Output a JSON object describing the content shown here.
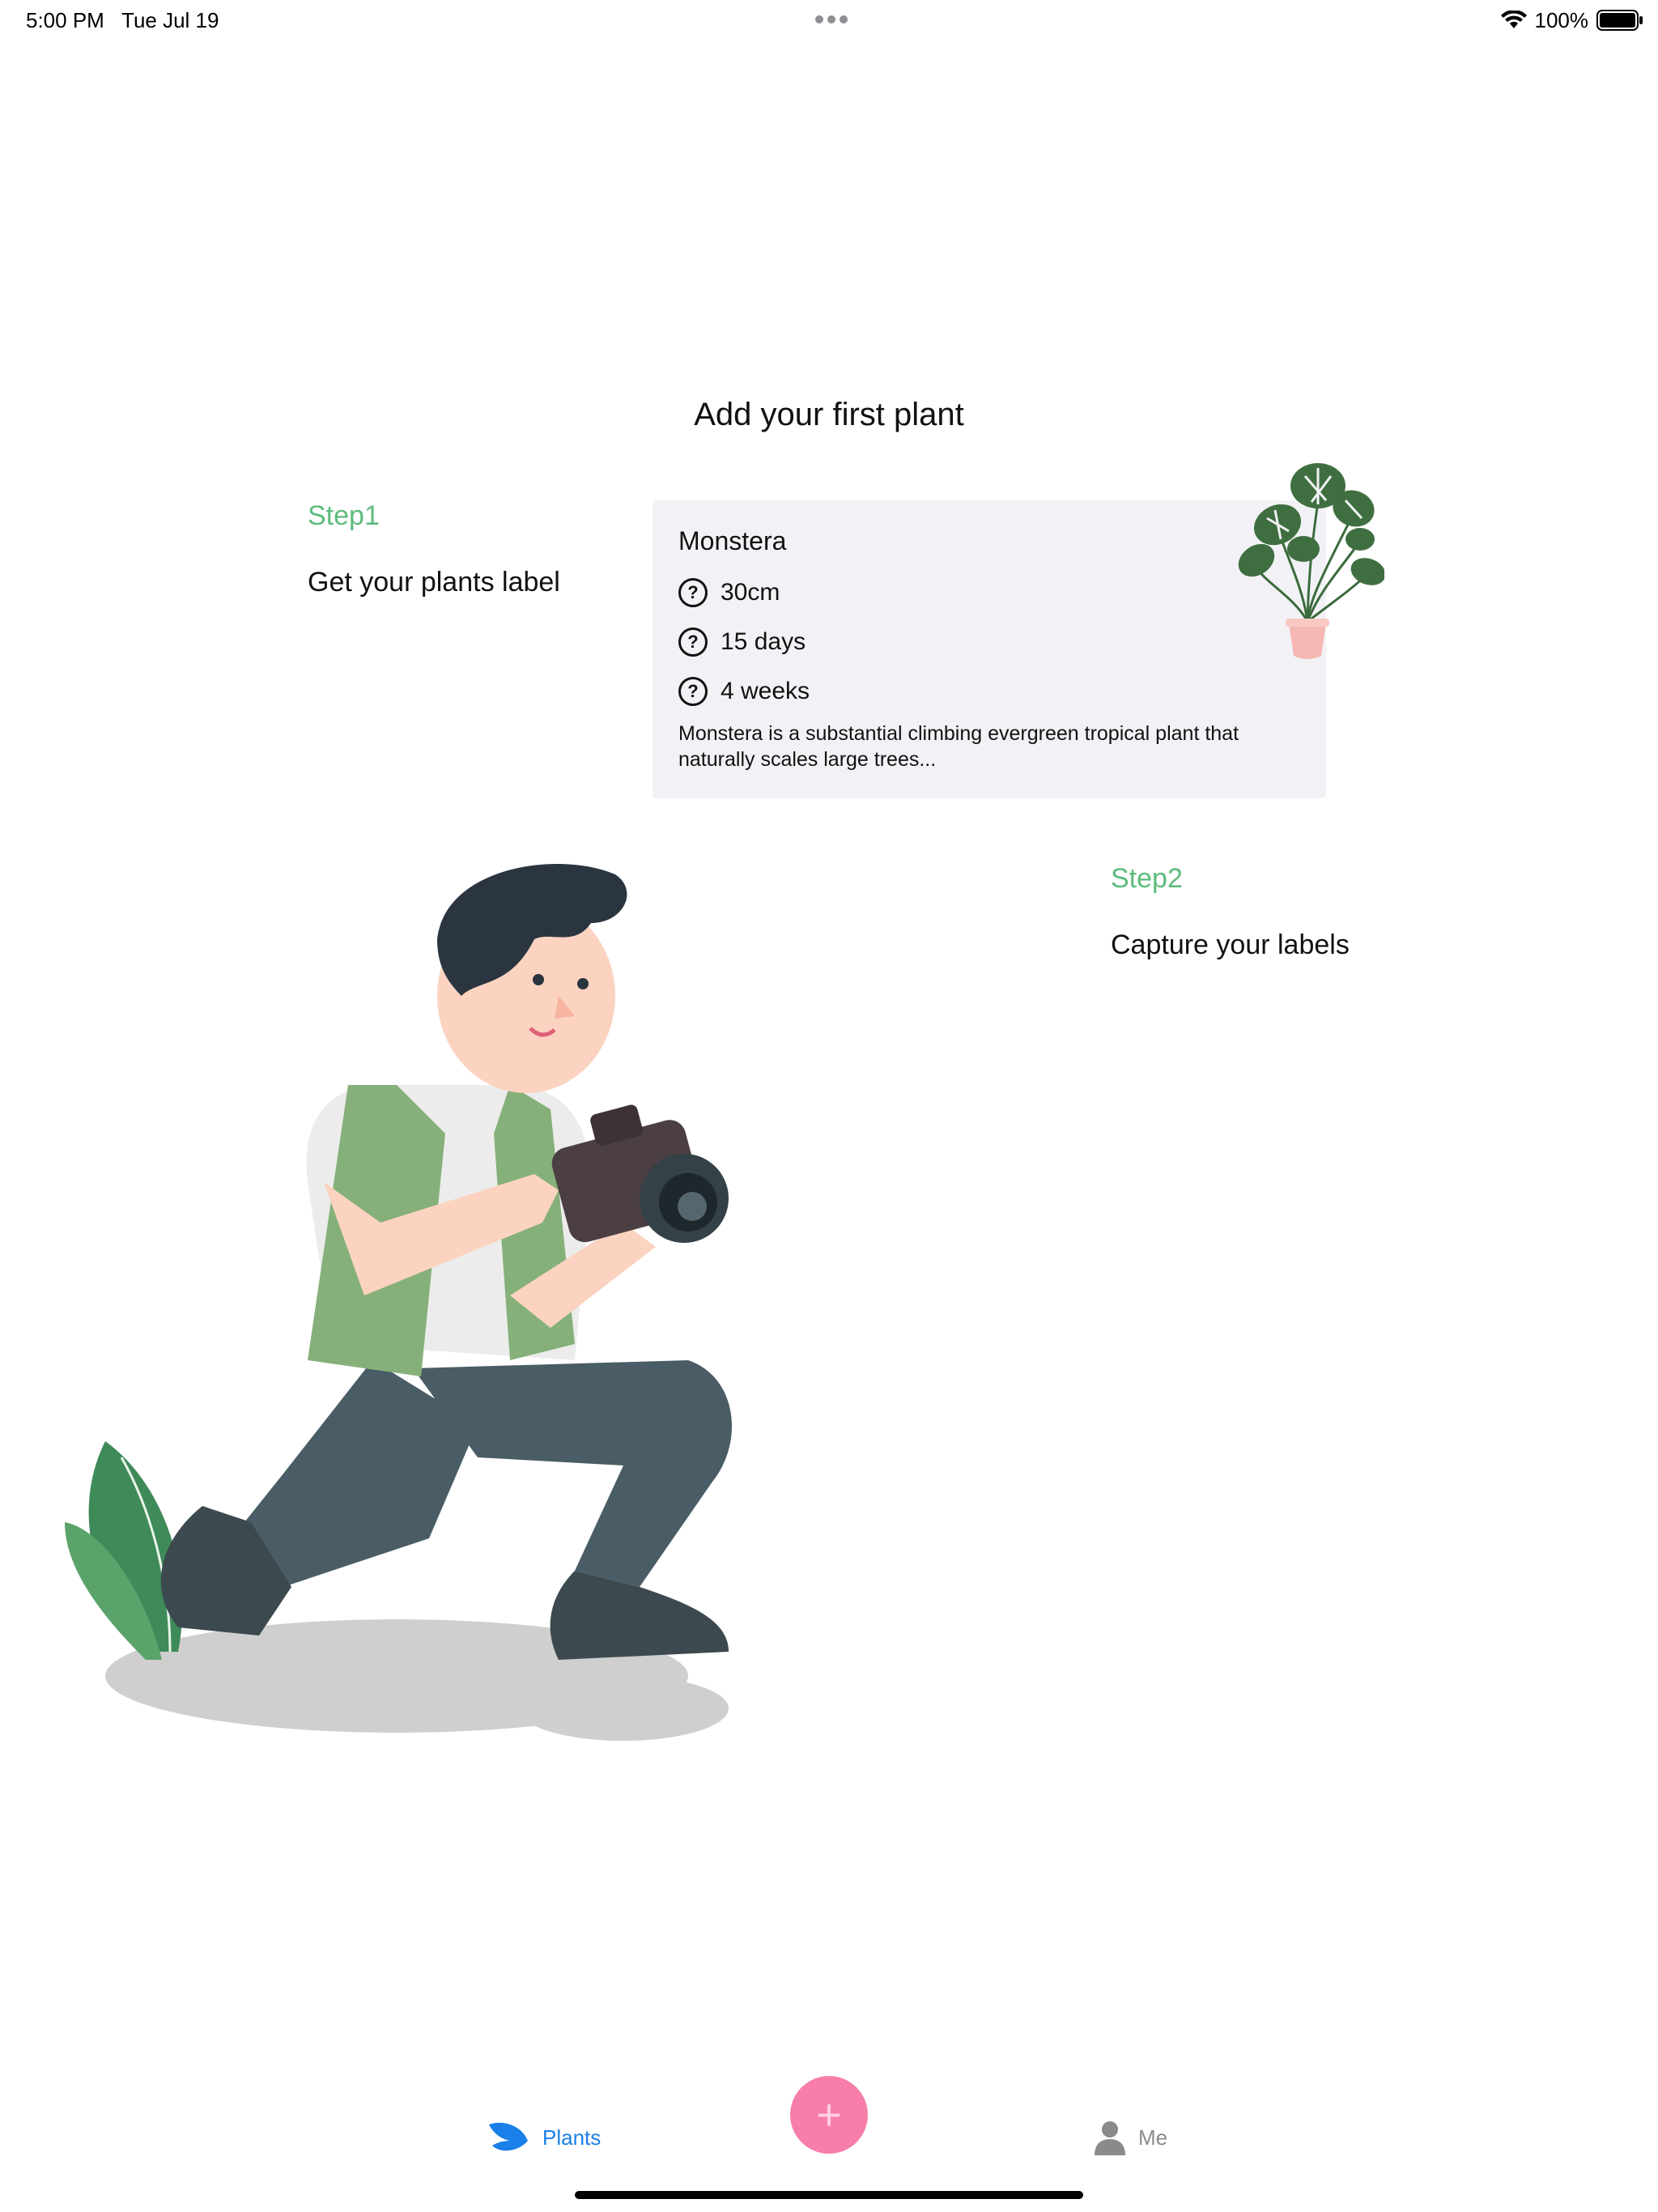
{
  "status_bar": {
    "time": "5:00 PM",
    "date": "Tue Jul 19",
    "battery": "100%"
  },
  "page": {
    "title": "Add your first plant"
  },
  "steps": [
    {
      "label": "Step1",
      "text": "Get your plants label"
    },
    {
      "label": "Step2",
      "text": "Capture your labels"
    }
  ],
  "plant_card": {
    "name": "Monstera",
    "rows": [
      {
        "icon": "question-circle-icon",
        "value": "30cm"
      },
      {
        "icon": "question-circle-icon",
        "value": "15 days"
      },
      {
        "icon": "question-circle-icon",
        "value": "4 weeks"
      }
    ],
    "description": "Monstera is a substantial climbing evergreen tropical plant that naturally scales large trees..."
  },
  "tab_bar": {
    "plants_label": "Plants",
    "me_label": "Me",
    "add_symbol": "+",
    "active_color": "#1a7fe8",
    "inactive_color": "#8a8a8a",
    "fab_color": "#f77eab"
  },
  "colors": {
    "step_accent": "#5dbb7c",
    "card_background": "#f2f2f6"
  }
}
